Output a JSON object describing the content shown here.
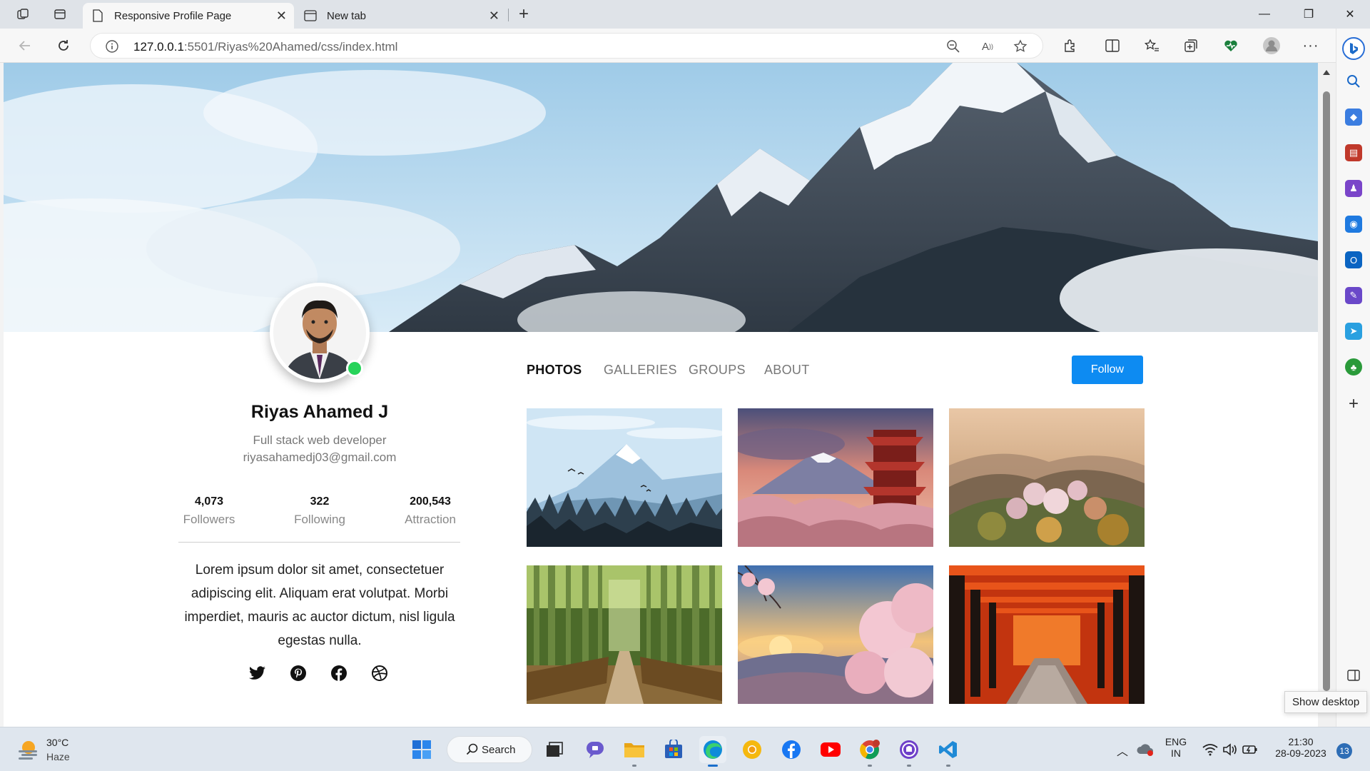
{
  "browser": {
    "tabs": [
      {
        "title": "Responsive Profile Page",
        "active": true
      },
      {
        "title": "New tab",
        "active": false
      }
    ],
    "url_host": "127.0.0.1",
    "url_path": ":5501/Riyas%20Ahamed/css/index.html"
  },
  "profile": {
    "name": "Riyas Ahamed J",
    "role": "Full stack web developer",
    "email": "riyasahamedj03@gmail.com",
    "online_color": "#27d35a",
    "stats": [
      {
        "value": "4,073",
        "label": "Followers"
      },
      {
        "value": "322",
        "label": "Following"
      },
      {
        "value": "200,543",
        "label": "Attraction"
      }
    ],
    "bio": "Lorem ipsum dolor sit amet, consectetuer adipiscing elit. Aliquam erat volutpat. Morbi imperdiet, mauris ac auctor dictum, nisl ligula egestas nulla.",
    "socials": [
      "twitter-icon",
      "pinterest-icon",
      "facebook-icon",
      "dribbble-icon"
    ]
  },
  "nav": {
    "links": [
      "PHOTOS",
      "GALLERIES",
      "GROUPS",
      "ABOUT"
    ],
    "active": "PHOTOS",
    "follow_label": "Follow",
    "follow_color": "#0d8bf2"
  },
  "gallery": [
    "snowy-mountain-illustration",
    "pagoda-mount-fuji",
    "blossom-valley",
    "bamboo-path",
    "cherry-blossom-sunset",
    "torii-gate-tunnel"
  ],
  "taskbar": {
    "weather_temp": "30°C",
    "weather_desc": "Haze",
    "search_label": "Search",
    "lang_line1": "ENG",
    "lang_line2": "IN",
    "time": "21:30",
    "date": "28-09-2023",
    "notification_count": "13",
    "tooltip": "Show desktop"
  }
}
